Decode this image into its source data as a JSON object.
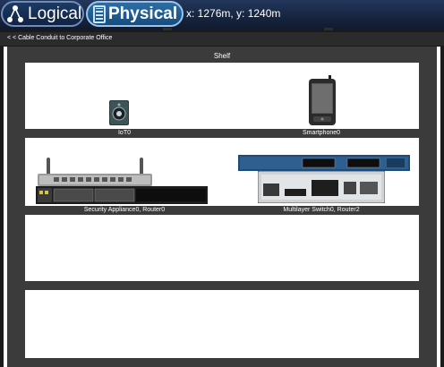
{
  "toolbar": {
    "logical_label": "Logical",
    "physical_label": "Physical",
    "coordinates": "x: 1276m, y: 1240m"
  },
  "navigation": {
    "breadcrumb": "< < Cable Conduit to Corporate Office"
  },
  "shelf": {
    "title": "Shelf",
    "slots": [
      {
        "label": "IoT0"
      },
      {
        "label": "Smartphone0"
      },
      {
        "label": "Security Appliance0, Router0"
      },
      {
        "label": "Multilayer Switch0, Router2"
      }
    ]
  },
  "icons": [
    "logical-network-icon",
    "physical-rack-icon",
    "iot-speaker-icon",
    "smartphone-icon",
    "wireless-router-icon",
    "security-appliance-icon",
    "multilayer-switch-icon",
    "router-icon"
  ],
  "colors": {
    "topbar": "#16243f",
    "active_mode": "#2a6ea6",
    "rack_frame": "#3b3b3b",
    "shelf_background": "#ffffff"
  }
}
